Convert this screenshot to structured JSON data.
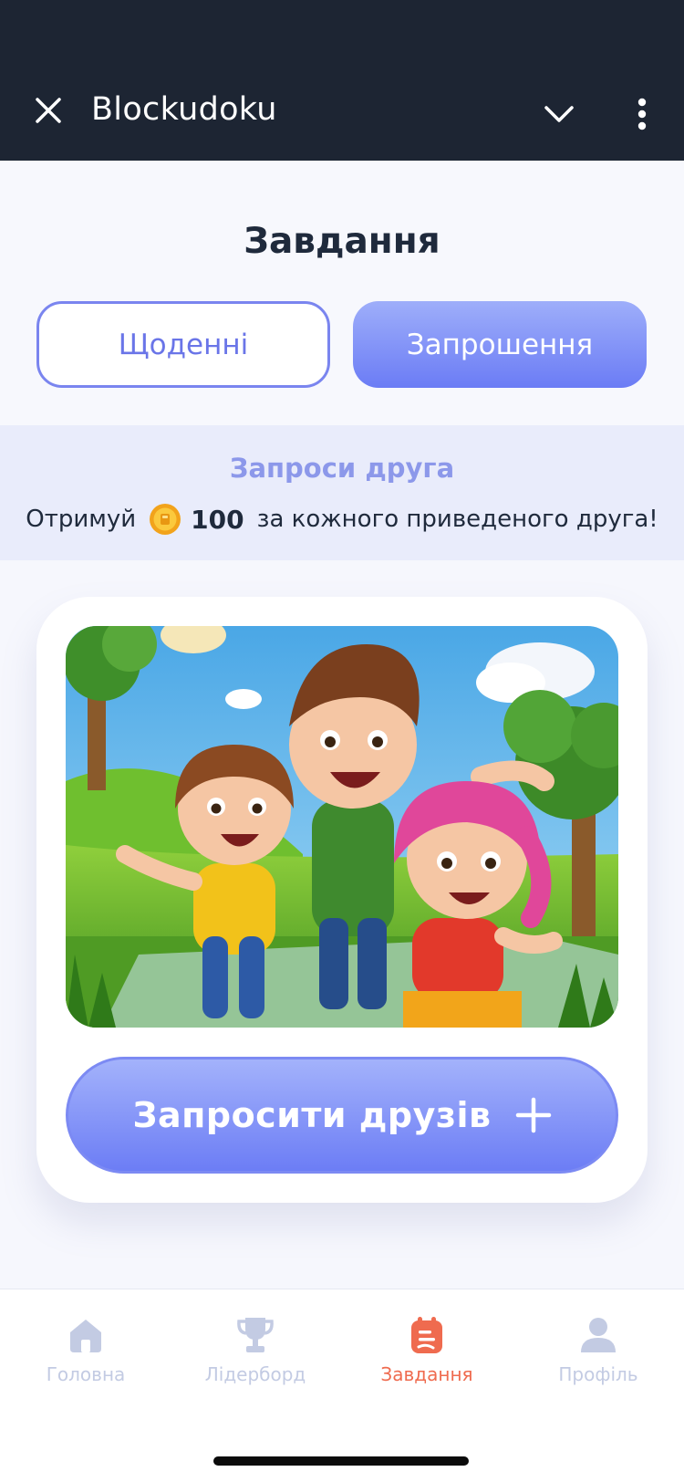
{
  "app": {
    "title": "Blockudoku"
  },
  "page": {
    "title": "Завдання",
    "tabs": [
      {
        "label": "Щоденні",
        "active": false
      },
      {
        "label": "Запрошення",
        "active": true
      }
    ]
  },
  "promo": {
    "title": "Запроси друга",
    "prefix": "Отримуй",
    "amount": "100",
    "suffix": "за кожного приведеного друга!",
    "coin_icon": "coin-icon"
  },
  "card": {
    "image_icon": "friends-illustration",
    "button_label": "Запросити друзів",
    "button_icon": "plus-icon"
  },
  "bottom_nav": {
    "items": [
      {
        "label": "Головна",
        "icon": "home-icon",
        "active": false
      },
      {
        "label": "Лідерборд",
        "icon": "trophy-icon",
        "active": false
      },
      {
        "label": "Завдання",
        "icon": "tasks-icon",
        "active": true
      },
      {
        "label": "Профіль",
        "icon": "profile-icon",
        "active": false
      }
    ]
  },
  "colors": {
    "accent": "#6b7cf5",
    "active_nav": "#ef6b4f",
    "topbar": "#1d2533"
  }
}
